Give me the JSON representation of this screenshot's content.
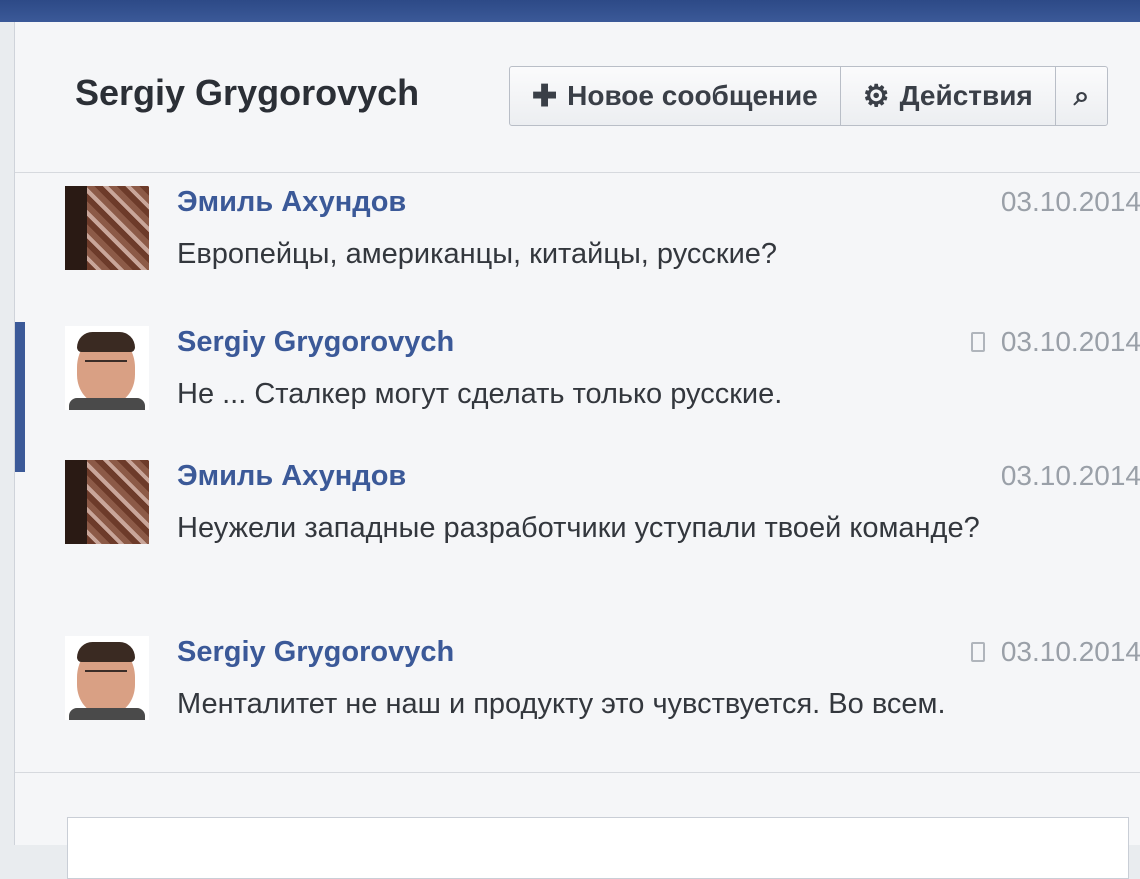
{
  "header": {
    "title": "Sergiy Grygorovych",
    "new_message_label": "Новое сообщение",
    "actions_label": "Действия"
  },
  "icons": {
    "new_message": "plus-icon",
    "actions": "gear-icon",
    "search": "search-icon",
    "device": "phone-icon"
  },
  "messages": [
    {
      "author": "Эмиль Ахундов",
      "date": "03.10.2014",
      "text": "Европейцы, американцы, китайцы, русские?",
      "avatar": "pattern"
    },
    {
      "author": "Sergiy Grygorovych",
      "date": "03.10.2014",
      "text": "Не ... Сталкер могут сделать только русские.",
      "avatar": "face",
      "device_icon": true
    },
    {
      "author": "Эмиль Ахундов",
      "date": "03.10.2014",
      "text": "Неужели западные разработчики уступали твоей команде?",
      "avatar": "pattern"
    },
    {
      "author": "Sergiy Grygorovych",
      "date": "03.10.2014",
      "text": "Менталитет не наш и продукту это чувствуется. Во всем.",
      "avatar": "face",
      "device_icon": true
    }
  ],
  "colors": {
    "author": "#3b5998",
    "date": "#9aa0a8",
    "text": "#33373d",
    "accent": "#3b5998"
  }
}
